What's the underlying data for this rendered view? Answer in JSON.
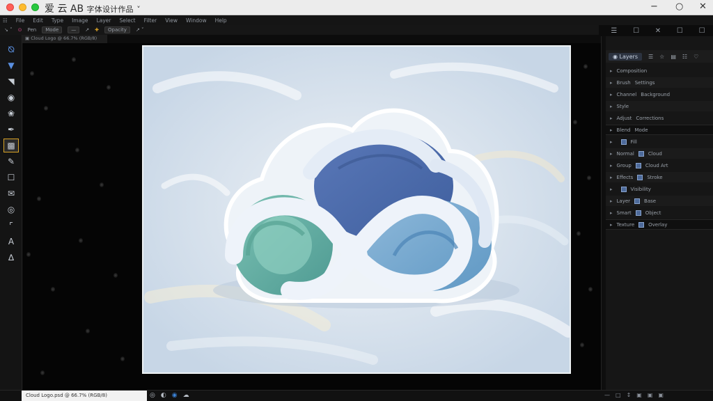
{
  "window": {
    "title_main": "爱 云 AB",
    "title_sub": "字体设计作品",
    "title_chevron": "˅",
    "right_icons": [
      "−",
      "○",
      "✕"
    ]
  },
  "menubar": {
    "items": [
      "☷",
      "File",
      "Edit",
      "Type",
      "Image",
      "Layer",
      "Select",
      "Filter",
      "View",
      "Window",
      "Help"
    ]
  },
  "optbar": {
    "items": [
      "↘ ˅",
      "⊙",
      "Pen",
      "Mode",
      "—",
      "↗",
      "✚",
      "Opacity",
      "↗ ˅"
    ]
  },
  "doc_tab": "▣ Cloud Logo @ 66.7% (RGB/8)",
  "top_right_icons": [
    "☰",
    "☐",
    "✕",
    "☐",
    "☐"
  ],
  "tools": [
    {
      "name": "lasso-icon",
      "glyph": "⦰"
    },
    {
      "name": "shield-icon",
      "glyph": "▼"
    },
    {
      "name": "select-icon",
      "glyph": "◥"
    },
    {
      "name": "eye-icon",
      "glyph": "◉"
    },
    {
      "name": "clone-icon",
      "glyph": "❀"
    },
    {
      "name": "pen-icon",
      "glyph": "✒"
    },
    {
      "name": "color-swatch-icon",
      "glyph": "▩"
    },
    {
      "name": "brush-icon",
      "glyph": "✎"
    },
    {
      "name": "type-icon",
      "glyph": "☐"
    },
    {
      "name": "chat-icon",
      "glyph": "✉"
    },
    {
      "name": "target-icon",
      "glyph": "◎"
    },
    {
      "name": "crop-icon",
      "glyph": "⌜"
    },
    {
      "name": "text-icon",
      "glyph": "A"
    },
    {
      "name": "shape-icon",
      "glyph": "∆"
    }
  ],
  "right_panel": {
    "tabs": [
      "◉ Layers",
      "☰",
      "☆",
      "▤",
      "☷",
      "♡"
    ],
    "rows": [
      {
        "label": "Composition",
        "value": ""
      },
      {
        "label": "Brush",
        "value": "Settings"
      },
      {
        "label": "Channel",
        "value": "Background"
      },
      {
        "label": "Style",
        "value": ""
      },
      {
        "label": "Adjust",
        "value": "Corrections"
      },
      {
        "label": "Blend",
        "value": "Mode"
      },
      {
        "label": "",
        "value": "Fill"
      },
      {
        "label": "Normal",
        "value": "Cloud"
      },
      {
        "label": "Group",
        "value": "Cloud Art"
      },
      {
        "label": "Effects",
        "value": "Stroke"
      },
      {
        "label": "",
        "value": "Visibility"
      },
      {
        "label": "Layer",
        "value": "Base"
      },
      {
        "label": "Smart",
        "value": "Object"
      },
      {
        "label": "Texture",
        "value": "Overlay"
      }
    ]
  },
  "status": {
    "text": "Cloud Logo.psd @ 66.7% (RGB/8)",
    "icons": [
      "◎",
      "◐",
      "◉",
      "☁"
    ],
    "right": [
      "—",
      "□",
      "↕",
      "▣",
      "▣",
      "▣"
    ]
  },
  "colors": {
    "accent": "#d9a326",
    "cloud_blue": "#4f6aa6",
    "cloud_teal": "#69b3a8",
    "cloud_white": "#e6eef6",
    "background": "#050505"
  }
}
